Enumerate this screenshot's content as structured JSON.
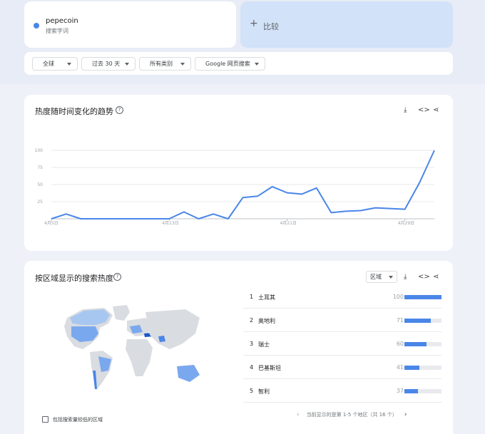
{
  "search_term": {
    "name": "pepecoin",
    "type": "搜索字词",
    "color": "#4a86e8"
  },
  "compare": {
    "label": "比较"
  },
  "filters": [
    {
      "label": "全球"
    },
    {
      "label": "过去 30 天"
    },
    {
      "label": "所有类别"
    },
    {
      "label": "Google 网页搜索"
    }
  ],
  "trend": {
    "title": "热度随时间变化的趋势",
    "icons": [
      "download-icon",
      "embed-icon",
      "share-icon"
    ]
  },
  "chart_data": {
    "type": "line",
    "x": [
      "4月5日",
      "4月6日",
      "4月7日",
      "4月8日",
      "4月9日",
      "4月10日",
      "4月11日",
      "4月12日",
      "4月13日",
      "4月14日",
      "4月15日",
      "4月16日",
      "4月17日",
      "4月18日",
      "4月19日",
      "4月20日",
      "4月21日",
      "4月22日",
      "4月23日",
      "4月24日",
      "4月25日",
      "4月26日",
      "4月27日",
      "4月28日",
      "4月29日",
      "4月30日",
      "5月1日"
    ],
    "xticks": [
      "4月5日",
      "4月13日",
      "4月21日",
      "4月29日"
    ],
    "yticks": [
      25,
      50,
      75,
      100
    ],
    "ylim": [
      0,
      100
    ],
    "series": [
      {
        "values": [
          0,
          7,
          0,
          0,
          0,
          0,
          0,
          0,
          0,
          10,
          0,
          7,
          0,
          31,
          33,
          47,
          38,
          36,
          45,
          9,
          11,
          12,
          16,
          15,
          14,
          53,
          100
        ]
      }
    ],
    "color": "#4a86e8",
    "grid": true
  },
  "region": {
    "title": "按区域显示的搜索热度",
    "select_label": "区域",
    "rows": [
      {
        "rank": "1",
        "name": "土耳其",
        "value": 100
      },
      {
        "rank": "2",
        "name": "奥地利",
        "value": 71
      },
      {
        "rank": "3",
        "name": "瑞士",
        "value": 60
      },
      {
        "rank": "4",
        "name": "巴基斯坦",
        "value": 41
      },
      {
        "rank": "5",
        "name": "智利",
        "value": 37
      }
    ],
    "pager": "当前显示的是第 1-5 个地区（共 16 个）",
    "checkbox_label": "包括搜索量较低的区域"
  }
}
